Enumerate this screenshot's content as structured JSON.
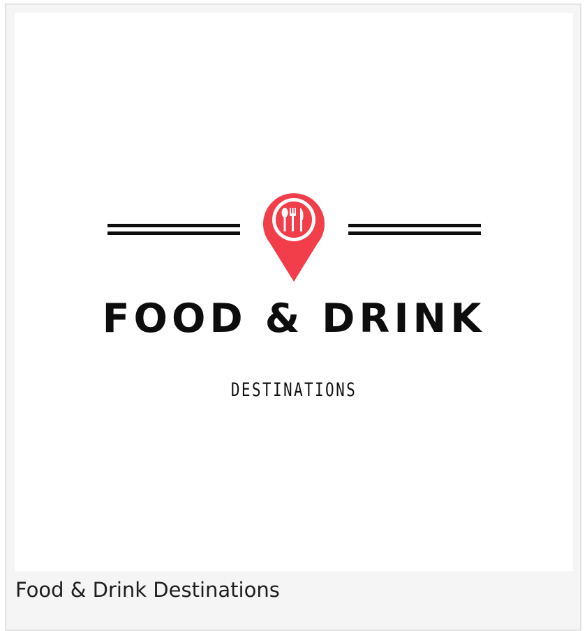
{
  "logo": {
    "title": "FOOD & DRINK",
    "subtitle": "DESTINATIONS",
    "pin_icon": "map-pin-utensils-icon",
    "accent_color": "#f23d4a",
    "text_color": "#0d0d0d"
  },
  "caption": {
    "text": "Food & Drink Destinations"
  }
}
